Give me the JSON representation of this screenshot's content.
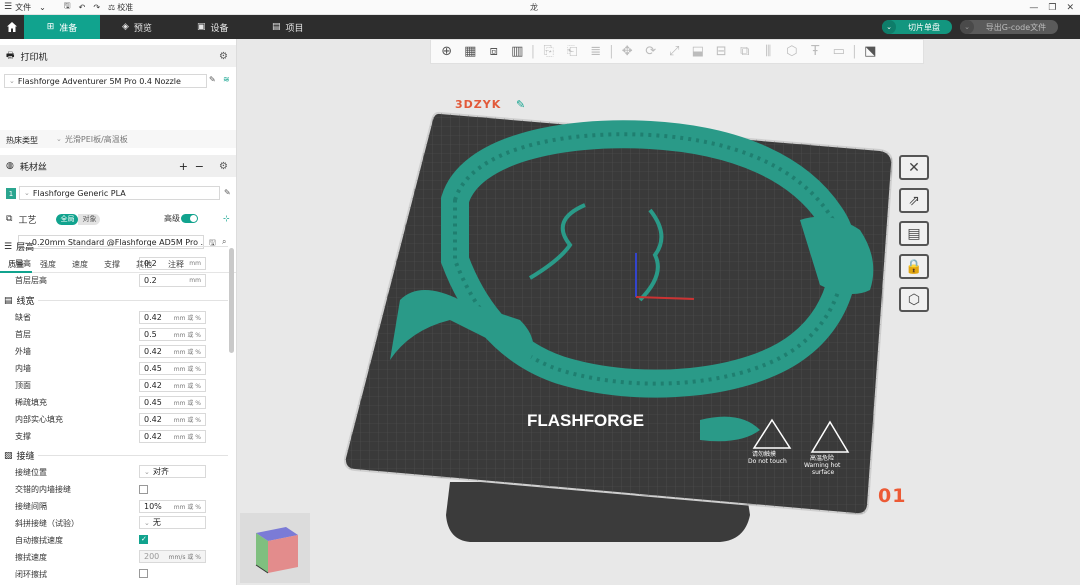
{
  "titlebar": {
    "file_menu": "文件",
    "calib": "校准",
    "center_title": "龙"
  },
  "nav": {
    "tabs": [
      {
        "label": "准备"
      },
      {
        "label": "预览"
      },
      {
        "label": "设备"
      },
      {
        "label": "项目"
      }
    ],
    "slice_label": "切片单盘",
    "export_label": "导出G-code文件"
  },
  "printer": {
    "header": "打印机",
    "selected": "Flashforge Adventurer 5M Pro 0.4 Nozzle",
    "bed_type_label": "热床类型",
    "bed_type_value": "光滑PEI板/高温板"
  },
  "filament": {
    "header": "耗材丝",
    "slot_num": "1",
    "selected": "Flashforge Generic PLA"
  },
  "process": {
    "header": "工艺",
    "seg_global": "全局",
    "seg_object": "对象",
    "advanced_label": "高级",
    "advanced_on": true,
    "profile": "0.20mm Standard @Flashforge AD5M Pro ...",
    "subtabs": [
      "质量",
      "强度",
      "速度",
      "支撑",
      "其他",
      "注释"
    ]
  },
  "groups": {
    "layer_height": {
      "title": "层高",
      "rows": [
        {
          "label": "层高",
          "value": "0.2",
          "unit": "mm"
        },
        {
          "label": "首层层高",
          "value": "0.2",
          "unit": "mm"
        }
      ]
    },
    "line_width": {
      "title": "线宽",
      "rows": [
        {
          "label": "缺省",
          "value": "0.42",
          "unit": "mm 或 %"
        },
        {
          "label": "首层",
          "value": "0.5",
          "unit": "mm 或 %"
        },
        {
          "label": "外墙",
          "value": "0.42",
          "unit": "mm 或 %"
        },
        {
          "label": "内墙",
          "value": "0.45",
          "unit": "mm 或 %"
        },
        {
          "label": "顶面",
          "value": "0.42",
          "unit": "mm 或 %"
        },
        {
          "label": "稀疏填充",
          "value": "0.45",
          "unit": "mm 或 %"
        },
        {
          "label": "内部实心填充",
          "value": "0.42",
          "unit": "mm 或 %"
        },
        {
          "label": "支撑",
          "value": "0.42",
          "unit": "mm 或 %"
        }
      ]
    },
    "seam": {
      "title": "接缝",
      "rows": [
        {
          "label": "接缝位置",
          "value": "对齐",
          "unit": ""
        },
        {
          "label": "交错的内墙接缝",
          "value": "",
          "unit": ""
        },
        {
          "label": "接缝间隔",
          "value": "10%",
          "unit": "mm 或 %"
        },
        {
          "label": "斜拼接缝（试验）",
          "value": "无",
          "unit": ""
        },
        {
          "label": "自动擦拭速度",
          "value": "",
          "unit": ""
        },
        {
          "label": "擦拭速度",
          "value": "200",
          "unit": "mm/s 或 %"
        },
        {
          "label": "闭环擦拭",
          "value": "",
          "unit": ""
        }
      ]
    }
  },
  "canvas": {
    "plate_name": "3DZYK",
    "plate_number": "01",
    "bed_logo": "FLASHFORGE",
    "warn1_line1": "请勿触摸",
    "warn1_line2": "Do not touch",
    "warn2_line1": "高温危险",
    "warn2_line2": "Warning hot",
    "warn2_line3": "surface"
  },
  "colors": {
    "accent": "#11a38e",
    "navbar": "#2d2d2d",
    "model": "#2a9a88",
    "bed": "#3a3a3a",
    "plate_num": "#ec5a35"
  }
}
